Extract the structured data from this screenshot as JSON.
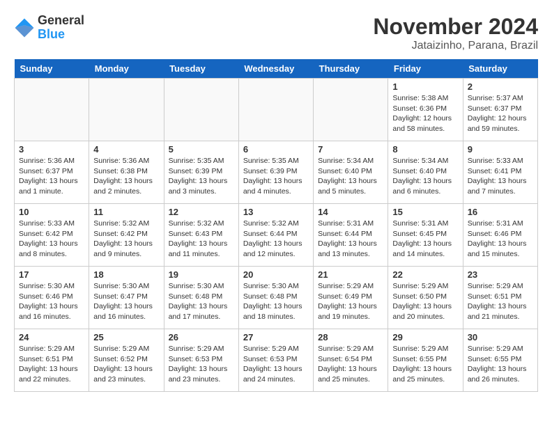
{
  "header": {
    "logo_line1": "General",
    "logo_line2": "Blue",
    "month": "November 2024",
    "location": "Jataizinho, Parana, Brazil"
  },
  "weekdays": [
    "Sunday",
    "Monday",
    "Tuesday",
    "Wednesday",
    "Thursday",
    "Friday",
    "Saturday"
  ],
  "weeks": [
    [
      {
        "day": "",
        "info": ""
      },
      {
        "day": "",
        "info": ""
      },
      {
        "day": "",
        "info": ""
      },
      {
        "day": "",
        "info": ""
      },
      {
        "day": "",
        "info": ""
      },
      {
        "day": "1",
        "info": "Sunrise: 5:38 AM\nSunset: 6:36 PM\nDaylight: 12 hours and 58 minutes."
      },
      {
        "day": "2",
        "info": "Sunrise: 5:37 AM\nSunset: 6:37 PM\nDaylight: 12 hours and 59 minutes."
      }
    ],
    [
      {
        "day": "3",
        "info": "Sunrise: 5:36 AM\nSunset: 6:37 PM\nDaylight: 13 hours and 1 minute."
      },
      {
        "day": "4",
        "info": "Sunrise: 5:36 AM\nSunset: 6:38 PM\nDaylight: 13 hours and 2 minutes."
      },
      {
        "day": "5",
        "info": "Sunrise: 5:35 AM\nSunset: 6:39 PM\nDaylight: 13 hours and 3 minutes."
      },
      {
        "day": "6",
        "info": "Sunrise: 5:35 AM\nSunset: 6:39 PM\nDaylight: 13 hours and 4 minutes."
      },
      {
        "day": "7",
        "info": "Sunrise: 5:34 AM\nSunset: 6:40 PM\nDaylight: 13 hours and 5 minutes."
      },
      {
        "day": "8",
        "info": "Sunrise: 5:34 AM\nSunset: 6:40 PM\nDaylight: 13 hours and 6 minutes."
      },
      {
        "day": "9",
        "info": "Sunrise: 5:33 AM\nSunset: 6:41 PM\nDaylight: 13 hours and 7 minutes."
      }
    ],
    [
      {
        "day": "10",
        "info": "Sunrise: 5:33 AM\nSunset: 6:42 PM\nDaylight: 13 hours and 8 minutes."
      },
      {
        "day": "11",
        "info": "Sunrise: 5:32 AM\nSunset: 6:42 PM\nDaylight: 13 hours and 9 minutes."
      },
      {
        "day": "12",
        "info": "Sunrise: 5:32 AM\nSunset: 6:43 PM\nDaylight: 13 hours and 11 minutes."
      },
      {
        "day": "13",
        "info": "Sunrise: 5:32 AM\nSunset: 6:44 PM\nDaylight: 13 hours and 12 minutes."
      },
      {
        "day": "14",
        "info": "Sunrise: 5:31 AM\nSunset: 6:44 PM\nDaylight: 13 hours and 13 minutes."
      },
      {
        "day": "15",
        "info": "Sunrise: 5:31 AM\nSunset: 6:45 PM\nDaylight: 13 hours and 14 minutes."
      },
      {
        "day": "16",
        "info": "Sunrise: 5:31 AM\nSunset: 6:46 PM\nDaylight: 13 hours and 15 minutes."
      }
    ],
    [
      {
        "day": "17",
        "info": "Sunrise: 5:30 AM\nSunset: 6:46 PM\nDaylight: 13 hours and 16 minutes."
      },
      {
        "day": "18",
        "info": "Sunrise: 5:30 AM\nSunset: 6:47 PM\nDaylight: 13 hours and 16 minutes."
      },
      {
        "day": "19",
        "info": "Sunrise: 5:30 AM\nSunset: 6:48 PM\nDaylight: 13 hours and 17 minutes."
      },
      {
        "day": "20",
        "info": "Sunrise: 5:30 AM\nSunset: 6:48 PM\nDaylight: 13 hours and 18 minutes."
      },
      {
        "day": "21",
        "info": "Sunrise: 5:29 AM\nSunset: 6:49 PM\nDaylight: 13 hours and 19 minutes."
      },
      {
        "day": "22",
        "info": "Sunrise: 5:29 AM\nSunset: 6:50 PM\nDaylight: 13 hours and 20 minutes."
      },
      {
        "day": "23",
        "info": "Sunrise: 5:29 AM\nSunset: 6:51 PM\nDaylight: 13 hours and 21 minutes."
      }
    ],
    [
      {
        "day": "24",
        "info": "Sunrise: 5:29 AM\nSunset: 6:51 PM\nDaylight: 13 hours and 22 minutes."
      },
      {
        "day": "25",
        "info": "Sunrise: 5:29 AM\nSunset: 6:52 PM\nDaylight: 13 hours and 23 minutes."
      },
      {
        "day": "26",
        "info": "Sunrise: 5:29 AM\nSunset: 6:53 PM\nDaylight: 13 hours and 23 minutes."
      },
      {
        "day": "27",
        "info": "Sunrise: 5:29 AM\nSunset: 6:53 PM\nDaylight: 13 hours and 24 minutes."
      },
      {
        "day": "28",
        "info": "Sunrise: 5:29 AM\nSunset: 6:54 PM\nDaylight: 13 hours and 25 minutes."
      },
      {
        "day": "29",
        "info": "Sunrise: 5:29 AM\nSunset: 6:55 PM\nDaylight: 13 hours and 25 minutes."
      },
      {
        "day": "30",
        "info": "Sunrise: 5:29 AM\nSunset: 6:55 PM\nDaylight: 13 hours and 26 minutes."
      }
    ]
  ]
}
